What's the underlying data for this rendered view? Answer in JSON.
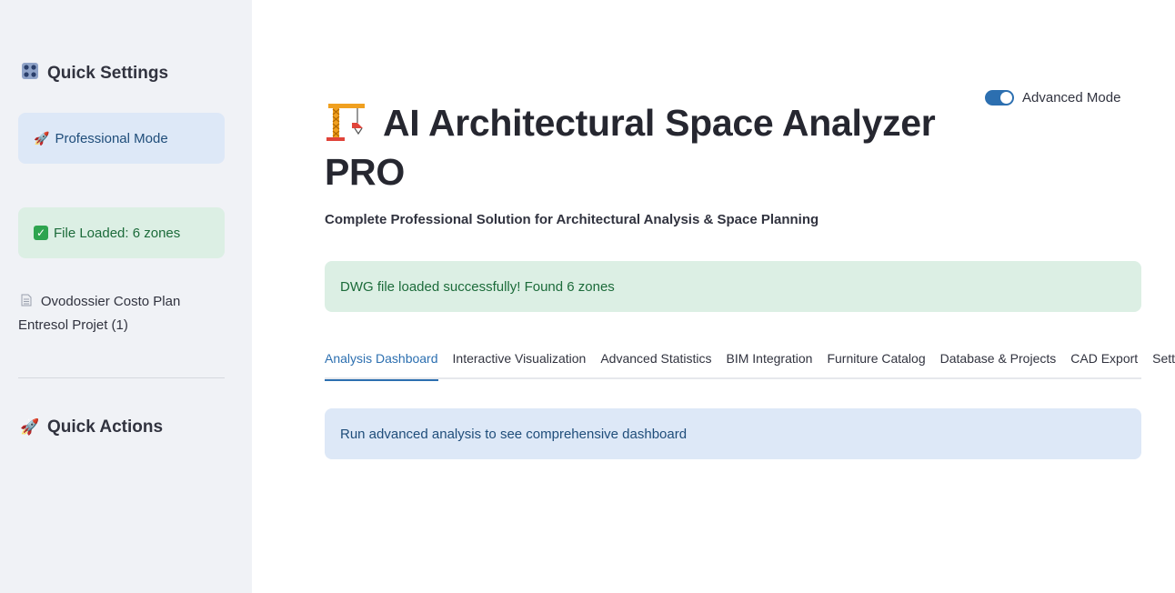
{
  "sidebar": {
    "quick_settings": {
      "icon": "control-knobs-icon",
      "label": "Quick Settings"
    },
    "mode_alert": {
      "icon": "rocket-icon",
      "label": "Professional Mode"
    },
    "file_alert": {
      "icon": "check-mark-icon",
      "label": "File Loaded: 6 zones"
    },
    "file_name": {
      "icon": "document-icon",
      "label": "Ovodossier Costo Plan Entresol Projet (1)"
    },
    "quick_actions": {
      "icon": "rocket-icon",
      "label": "Quick Actions"
    }
  },
  "header": {
    "toggle_label": "Advanced Mode",
    "toggle_on": true,
    "title_icon": "construction-crane-icon",
    "title": "AI Architectural Space Analyzer PRO",
    "subtitle": "Complete Professional Solution for Architectural Analysis & Space Planning"
  },
  "main": {
    "success_message": "DWG file loaded successfully! Found 6 zones",
    "tabs": [
      {
        "label": "Analysis Dashboard",
        "active": true
      },
      {
        "label": "Interactive Visualization",
        "active": false
      },
      {
        "label": "Advanced Statistics",
        "active": false
      },
      {
        "label": "BIM Integration",
        "active": false
      },
      {
        "label": "Furniture Catalog",
        "active": false
      },
      {
        "label": "Database & Projects",
        "active": false
      },
      {
        "label": "CAD Export",
        "active": false
      },
      {
        "label": "Settings",
        "active": false
      }
    ],
    "info_message": "Run advanced analysis to see comprehensive dashboard"
  },
  "colors": {
    "accent": "#2c6fb0",
    "sidebar_bg": "#f0f2f6",
    "info_bg": "#dde8f7",
    "success_bg": "#dcefe4"
  }
}
